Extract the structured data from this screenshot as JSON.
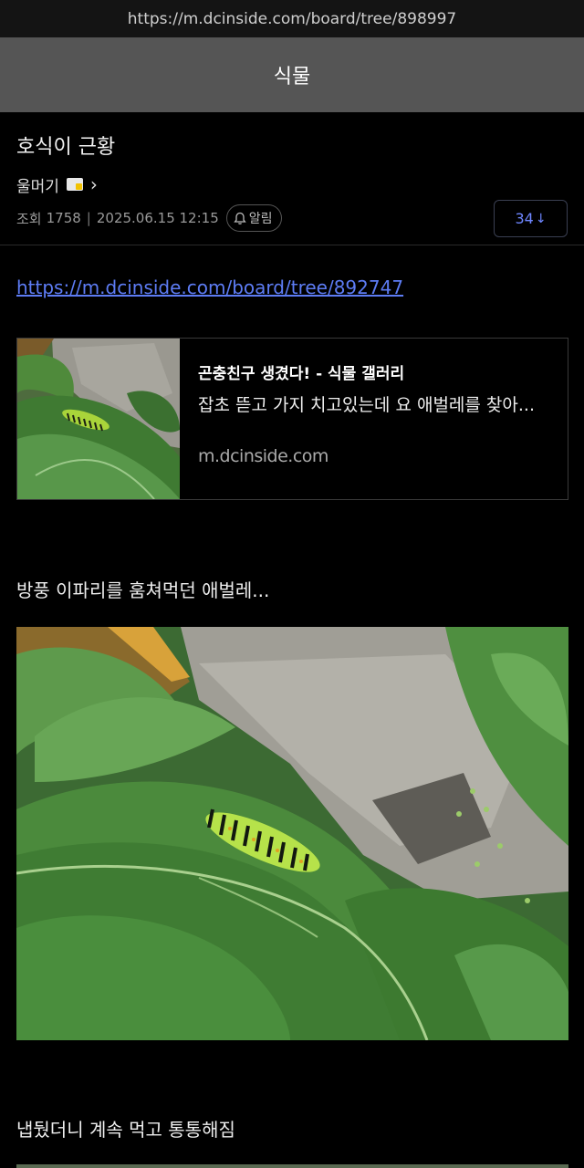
{
  "browser": {
    "url": "https://m.dcinside.com/board/tree/898997"
  },
  "gallery": {
    "name": "식물"
  },
  "post": {
    "title": "호식이 근황",
    "author": "울머기",
    "views_label": "조회",
    "views": "1758",
    "date": "2025.06.15 12:15",
    "alarm_label": "알림",
    "comment_count": "34",
    "comment_arrow": "↓"
  },
  "content": {
    "link_url": "https://m.dcinside.com/board/tree/892747",
    "link_card": {
      "title": "곤충친구 생겼다! - 식물 갤러리",
      "description": "잡초 뜯고 가지 치고있는데 요 애벌레를 찾아...",
      "domain": "m.dcinside.com"
    },
    "paragraph_1": "방풍 이파리를 훔쳐먹던 애벌레...",
    "paragraph_2": "냅뒀더니 계속 먹고 통통해짐"
  },
  "icons": {
    "author_badge": "gallery-badge-icon",
    "author_chevron": "chevron-right-icon",
    "alarm": "bell-icon",
    "comment_arrow": "arrow-down-icon"
  },
  "colors": {
    "background": "#000000",
    "header": "#555555",
    "link": "#5d7cf4",
    "comment_accent": "#6e86ff"
  }
}
